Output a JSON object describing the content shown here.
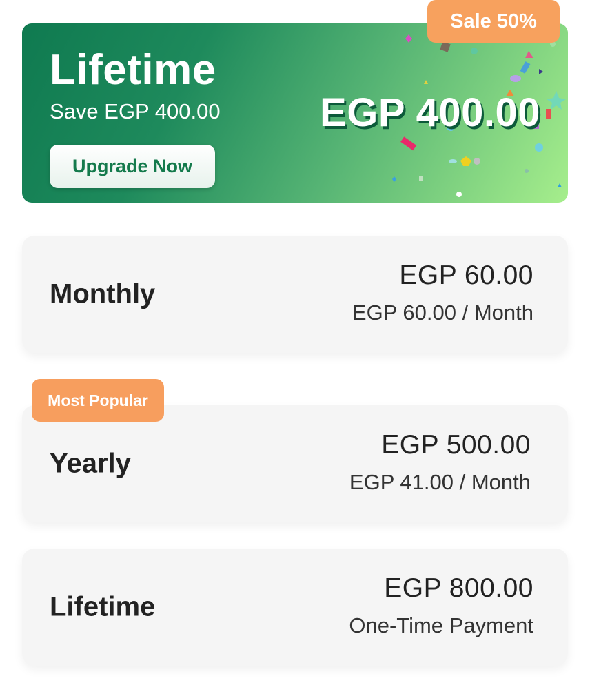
{
  "hero": {
    "title": "Lifetime",
    "subtitle": "Save EGP 400.00",
    "button_label": "Upgrade Now",
    "price": "EGP 400.00",
    "sale_badge": "Sale 50%"
  },
  "plans": [
    {
      "name": "Monthly",
      "price": "EGP 60.00",
      "detail": "EGP 60.00 / Month"
    },
    {
      "name": "Yearly",
      "price": "EGP 500.00",
      "detail": "EGP 41.00 / Month",
      "badge": "Most Popular"
    },
    {
      "name": "Lifetime",
      "price": "EGP 800.00",
      "detail": "One-Time Payment"
    }
  ],
  "colors": {
    "accent_green": "#147a4c",
    "badge_orange": "#f7a15e",
    "card_bg": "#f5f5f5"
  }
}
